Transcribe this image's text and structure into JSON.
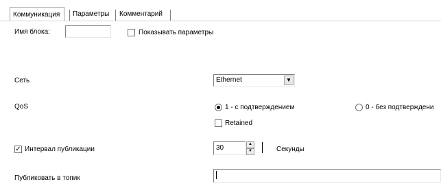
{
  "tabs": [
    {
      "label": "Коммуникация",
      "active": true
    },
    {
      "label": "Параметры",
      "active": false
    },
    {
      "label": "Комментарий",
      "active": false
    }
  ],
  "block_name": {
    "label": "Имя блока:",
    "value": ""
  },
  "show_params": {
    "label": "Показывать параметры",
    "checked": false
  },
  "network": {
    "label": "Сеть",
    "selected": "Ethernet",
    "dropdown_icon": "chevron-down-icon"
  },
  "qos": {
    "label": "QoS",
    "option1": {
      "label": "1 - с подтверждением",
      "selected": true
    },
    "option0": {
      "label": "0 - без подтверждени",
      "selected": false
    },
    "retained": {
      "label": "Retained",
      "checked": false
    }
  },
  "publish_interval": {
    "label": "Интервал публикации",
    "checked": true,
    "value": "30",
    "unit": "Секунды"
  },
  "publish_topic": {
    "label": "Публиковать в топик",
    "value": ""
  }
}
